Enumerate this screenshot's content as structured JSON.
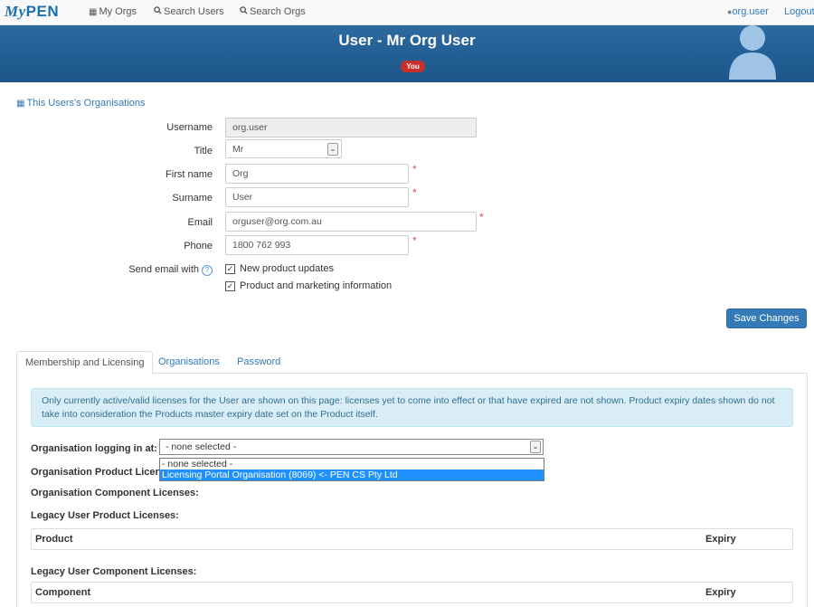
{
  "nav": {
    "brand_my": "My",
    "brand_pen": "PEN",
    "my_orgs": "My Orgs",
    "search_users": "Search Users",
    "search_orgs": "Search Orgs",
    "user_link": "org.user",
    "logout": "Logout",
    "icons": {
      "my_orgs": "building-icon",
      "search": "search-icon",
      "user": "user-icon"
    }
  },
  "banner": {
    "title": "User - Mr Org User",
    "badge": "You",
    "avatar": "user-silhouette-avatar"
  },
  "section_link": "This Users's Organisations",
  "form": {
    "username": {
      "label": "Username",
      "value": "org.user"
    },
    "title": {
      "label": "Title",
      "value": "Mr"
    },
    "first_name": {
      "label": "First name",
      "value": "Org"
    },
    "surname": {
      "label": "Surname",
      "value": "User"
    },
    "email": {
      "label": "Email",
      "value": "orguser@org.com.au"
    },
    "phone": {
      "label": "Phone",
      "value": "1800 762 993"
    },
    "send_email": {
      "label": "Send email with",
      "options": [
        {
          "label": "New product updates",
          "checked": true
        },
        {
          "label": "Product and marketing information",
          "checked": true
        }
      ]
    },
    "required_mark": "*",
    "save_button": "Save Changes"
  },
  "tabs": [
    {
      "label": "Membership and Licensing",
      "active": true
    },
    {
      "label": "Organisations",
      "active": false
    },
    {
      "label": "Password",
      "active": false
    }
  ],
  "info_text": "Only currently active/valid licenses for the User are shown on this page: licenses yet to come into effect or that have expired are not shown. Product expiry dates shown do not take into consideration the Products master expiry date set on the Product itself.",
  "org_login": {
    "label": "Organisation logging in at:",
    "selected": "- none selected -",
    "options": [
      "- none selected -",
      "Licensing Portal Organisation (8069) <- PEN CS Pty Ltd"
    ]
  },
  "sections": {
    "org_product_licenses": "Organisation Product Licen",
    "org_component_licenses": "Organisation Component Licenses:",
    "legacy_product_licenses": "Legacy User Product Licenses:",
    "legacy_component_licenses": "Legacy User Component Licenses:"
  },
  "product_table": {
    "col1": "Product",
    "col2": "Expiry"
  },
  "component_table": {
    "col1": "Component",
    "col2": "Expiry"
  },
  "colors": {
    "primary": "#337ab7",
    "banner": "#1f5b91",
    "badge": "#c9302c",
    "info_bg": "#d9edf7"
  }
}
